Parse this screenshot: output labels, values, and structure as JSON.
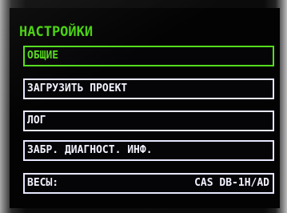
{
  "screen": {
    "title": "НАСТРОЙКИ"
  },
  "menu": {
    "items": [
      {
        "label": "ОБЩИЕ",
        "selected": true
      },
      {
        "label": "ЗАГРУЗИТЬ ПРОЕКТ",
        "selected": false
      },
      {
        "label": "ЛОГ",
        "selected": false
      },
      {
        "label": "ЗАБР. ДИАГНОСТ. ИНФ.",
        "selected": false
      },
      {
        "label": "ВЕСЫ:",
        "value": "CAS DB-1H/AD",
        "selected": false
      }
    ]
  },
  "colors": {
    "accent_green": "#47d10d",
    "item_border": "#e7e7ff",
    "background": "#030303"
  }
}
